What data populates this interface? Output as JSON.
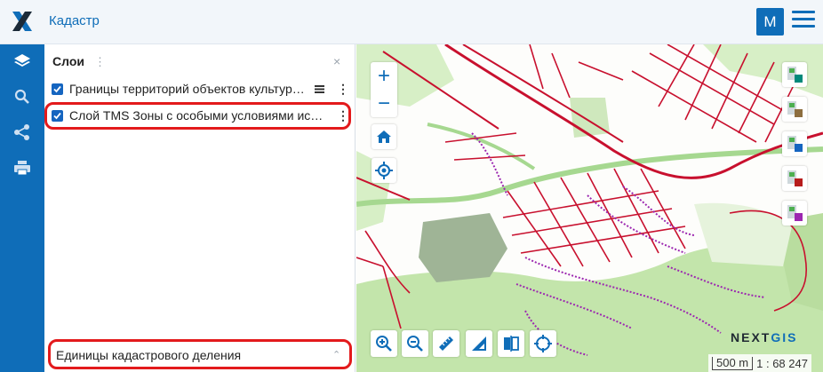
{
  "header": {
    "app_title": "Кадастр",
    "user_initial": "М",
    "menu_icon": "hamburger-icon"
  },
  "rail": {
    "items": [
      {
        "icon": "layers-icon"
      },
      {
        "icon": "search-icon"
      },
      {
        "icon": "share-icon"
      },
      {
        "icon": "print-icon"
      }
    ]
  },
  "panel": {
    "title": "Слои",
    "dots": "⋮",
    "close": "×",
    "layers": [
      {
        "label": "Границы территорий объектов культурного наследия",
        "checked": true,
        "legend_icon": "legend-icon"
      },
      {
        "label": "Слой TMS Зоны с особыми условиями использования территории",
        "checked": true
      }
    ],
    "basemap_label": "Единицы кадастрового деления",
    "basemap_chevron": "⌃"
  },
  "map": {
    "zoom_in": "+",
    "zoom_out": "−",
    "brand_prefix": "NEXT",
    "brand_suffix": "GIS",
    "scale_bar": "500 m",
    "scale_ratio": "1 : 68 247"
  },
  "colors": {
    "accent": "#0f6db8",
    "highlight": "#e31a1c",
    "parcel_lines": "#c8102e",
    "zones": "#9c27b0",
    "green": "#bde5a4"
  }
}
